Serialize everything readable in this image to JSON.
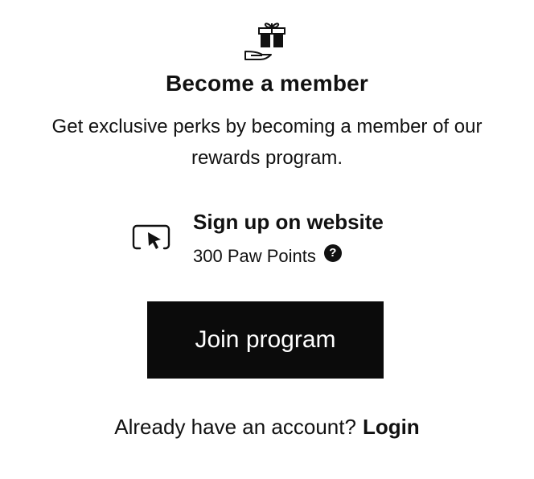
{
  "icons": {
    "gift": "gift-in-hand-icon",
    "perk": "cursor-click-icon",
    "help": "question-mark-icon"
  },
  "header": {
    "title": "Become a member",
    "description": "Get exclusive perks by becoming a member of our rewards program."
  },
  "perk": {
    "title": "Sign up on website",
    "points": "300 Paw Points",
    "help_glyph": "?"
  },
  "actions": {
    "join_label": "Join program"
  },
  "footer": {
    "prompt": "Already have an account?",
    "login_label": "Login"
  },
  "colors": {
    "primary": "#0b0b0b",
    "text": "#111111",
    "background": "#ffffff"
  }
}
